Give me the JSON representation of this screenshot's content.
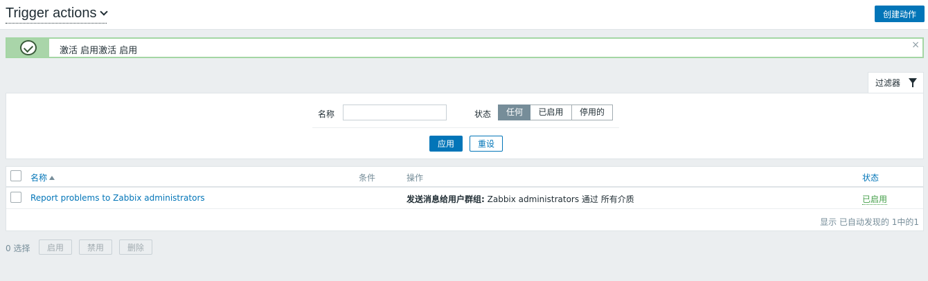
{
  "header": {
    "title": "Trigger actions",
    "create_label": "创建动作"
  },
  "message": {
    "text": "激活 启用激活 启用",
    "close": "×"
  },
  "filter": {
    "tab_label": "过滤器",
    "name_label": "名称",
    "name_value": "",
    "status_label": "状态",
    "status_options": [
      "任何",
      "已启用",
      "停用的"
    ],
    "status_selected": "任何",
    "apply_label": "应用",
    "reset_label": "重设"
  },
  "table": {
    "columns": [
      "名称",
      "条件",
      "操作",
      "状态"
    ],
    "rows": [
      {
        "name": "Report problems to Zabbix administrators",
        "conditions": "",
        "operation_bold": "发送消息给用户群组:",
        "operation_text": " Zabbix administrators 通过 所有介质",
        "status": "已启用"
      }
    ],
    "footer": "显示 已自动发现的 1中的1"
  },
  "bulk": {
    "selected_count": "0 选择",
    "enable_label": "启用",
    "disable_label": "禁用",
    "delete_label": "删除"
  },
  "colors": {
    "accent": "#0275b8",
    "success": "#429e47",
    "message_border": "#a4d6a4"
  }
}
